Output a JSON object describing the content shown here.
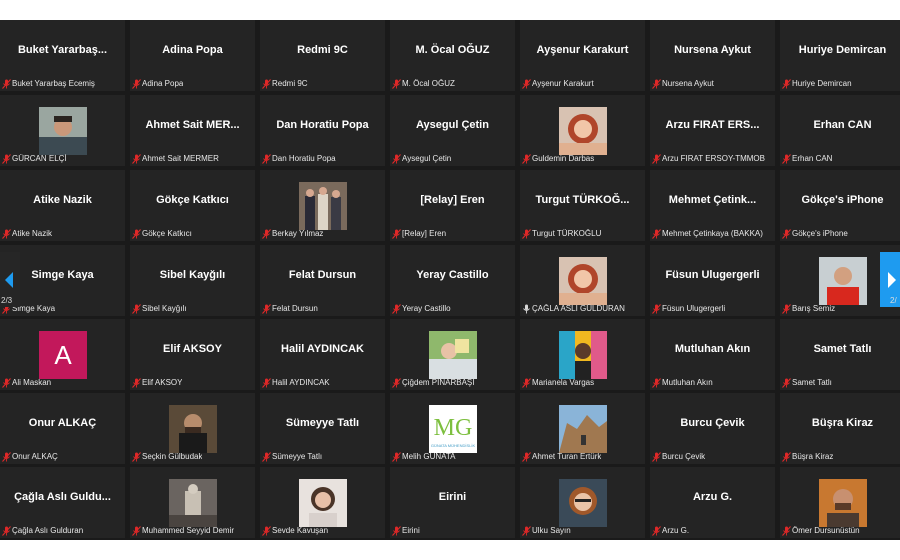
{
  "gallery": {
    "prev_page_indicator": "2/3",
    "next_page_indicator": "2/",
    "colors": {
      "tile_bg": "#242424",
      "muted_icon": "#e02828",
      "nav_active": "#1e9bf0"
    },
    "tiles": [
      {
        "display": "Buket  Yararbaş...",
        "label": "Buket Yararbaş Ecemiş",
        "muted": true
      },
      {
        "display": "Adina Popa",
        "label": "Adina Popa",
        "muted": true
      },
      {
        "display": "Redmi 9C",
        "label": "Redmi 9C",
        "muted": true
      },
      {
        "display": "M. Öcal OĞUZ",
        "label": "M. Öcal OĞUZ",
        "muted": true
      },
      {
        "display": "Ayşenur Karakurt",
        "label": "Ayşenur Karakurt",
        "muted": true
      },
      {
        "display": "Nursena Aykut",
        "label": "Nursena Aykut",
        "muted": true
      },
      {
        "display": "Huriye Demircan",
        "label": "Huriye Demircan",
        "muted": true
      },
      {
        "display": "",
        "label": "GÜRCAN ELÇİ",
        "muted": true,
        "photo": "man-portrait"
      },
      {
        "display": "Ahmet Sait  MER...",
        "label": "Ahmet Sait MERMER",
        "muted": true
      },
      {
        "display": "Dan Horatiu Popa",
        "label": "Dan Horatiu Popa",
        "muted": true
      },
      {
        "display": "Aysegul Çetin",
        "label": "Aysegul Çetin",
        "muted": true
      },
      {
        "display": "",
        "label": "Guldemin Darbas",
        "muted": true,
        "photo": "woman-portrait"
      },
      {
        "display": "Arzu  FIRAT  ERS...",
        "label": "Arzu FIRAT ERSOY-TMMOB",
        "muted": true
      },
      {
        "display": "Erhan CAN",
        "label": "Erhan CAN",
        "muted": true
      },
      {
        "display": "Atike Nazik",
        "label": "Atike Nazik",
        "muted": true
      },
      {
        "display": "Gökçe Katkıcı",
        "label": "Gökçe Katkıcı",
        "muted": true
      },
      {
        "display": "",
        "label": "Berkay Yılmaz",
        "muted": true,
        "photo": "group-photo"
      },
      {
        "display": "[Relay] Eren",
        "label": "[Relay] Eren",
        "muted": true
      },
      {
        "display": "Turgut  TÜRKOĞ...",
        "label": "Turgut TÜRKOĞLU",
        "muted": true
      },
      {
        "display": "Mehmet  Çetink...",
        "label": "Mehmet Çetinkaya (BAKKA)",
        "muted": true
      },
      {
        "display": "Gökçe's iPhone",
        "label": "Gökçe's iPhone",
        "muted": true
      },
      {
        "display": "Simge Kaya",
        "label": "Simge Kaya",
        "muted": true
      },
      {
        "display": "Sibel Kayğılı",
        "label": "Sibel Kayğılı",
        "muted": true
      },
      {
        "display": "Felat Dursun",
        "label": "Felat Dursun",
        "muted": true
      },
      {
        "display": "Yeray Castillo",
        "label": "Yeray Castillo",
        "muted": true
      },
      {
        "display": "",
        "label": "ÇAĞLA ASLI GÜLDURAN",
        "muted": false,
        "photo": "woman-portrait"
      },
      {
        "display": "Füsun Ulugergerli",
        "label": "Füsun Ulugergerli",
        "muted": true
      },
      {
        "display": "",
        "label": "Barış Semiz",
        "muted": true,
        "photo": "man-red-shirt"
      },
      {
        "display": "",
        "label": "Ali Maskan",
        "muted": true,
        "avatar_letter": "A"
      },
      {
        "display": "Elif AKSOY",
        "label": "Elif AKSOY",
        "muted": true
      },
      {
        "display": "Halil AYDINCAK",
        "label": "Halil AYDINCAK",
        "muted": true
      },
      {
        "display": "",
        "label": "Çiğdem PINARBAŞI",
        "muted": true,
        "photo": "outdoor-photo"
      },
      {
        "display": "",
        "label": "Marianela Vargas",
        "muted": true,
        "photo": "colorful-photo"
      },
      {
        "display": "Mutluhan Akın",
        "label": "Mutluhan Akın",
        "muted": true
      },
      {
        "display": "Samet Tatlı",
        "label": "Samet Tatlı",
        "muted": true
      },
      {
        "display": "Onur ALKAÇ",
        "label": "Onur ALKAÇ",
        "muted": true
      },
      {
        "display": "",
        "label": "Seçkin Gülbudak",
        "muted": true,
        "photo": "man-dark"
      },
      {
        "display": "Sümeyye Tatlı",
        "label": "Sümeyye Tatlı",
        "muted": true
      },
      {
        "display": "",
        "label": "Melih GÜNATA",
        "muted": true,
        "photo": "mg-logo",
        "logo_text": "MG",
        "logo_caption": "GÜNATA MÜHENDİSLİK"
      },
      {
        "display": "",
        "label": "Ahmet Turan Ertürk",
        "muted": true,
        "photo": "rocky-landscape"
      },
      {
        "display": "Burcu Çevik",
        "label": "Burcu Çevik",
        "muted": true
      },
      {
        "display": "Büşra Kiraz",
        "label": "Büşra Kiraz",
        "muted": true
      },
      {
        "display": "Çağla  Aslı  Guldu...",
        "label": "Çağla Aslı Gulduran",
        "muted": true
      },
      {
        "display": "",
        "label": "Muhammed Seyyid Demir",
        "muted": true,
        "photo": "statue-photo"
      },
      {
        "display": "",
        "label": "Sevde Kavuşan",
        "muted": true,
        "photo": "woman-light"
      },
      {
        "display": "Eirini",
        "label": "Eirini",
        "muted": true
      },
      {
        "display": "",
        "label": "Ulku Sayın",
        "muted": true,
        "photo": "woman-glasses"
      },
      {
        "display": "Arzu G.",
        "label": "Arzu G.",
        "muted": true
      },
      {
        "display": "",
        "label": "Ömer Dursunüstün",
        "muted": true,
        "photo": "man-orange"
      }
    ]
  }
}
